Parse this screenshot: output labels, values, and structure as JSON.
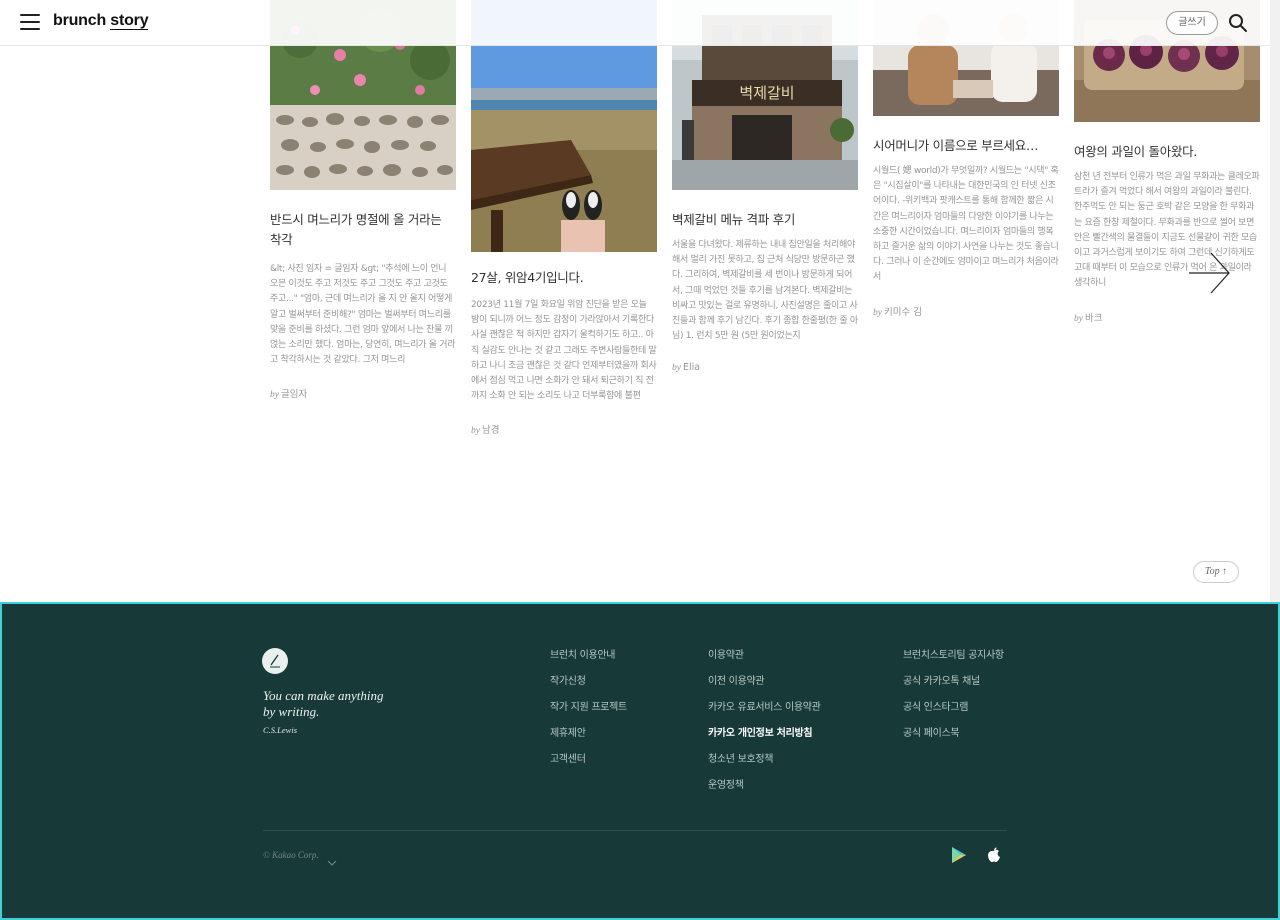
{
  "header": {
    "logo_text_a": "brunch",
    "logo_text_b": "story",
    "write_label": "글쓰기"
  },
  "articles": [
    {
      "title": "반드시 며느리가 명절에 올 거라는 착각",
      "desc": "&lt; 사진 임자 = 글임자 &gt; \"추석에 느이 언니 오믄 이것도 주고 저것도 주고 그것도 주고 고것도 주고...\" \"엄마, 근데 며느리가 올 지 안 올지 어떻게 알고 벌써부터 준비해?\" 엄마는 벌써부터 며느리를 맞을 준비를 하셨다. 그런 엄마 앞에서 나는 찬물 끼얹는 소리만 했다. 엄마는, 당연히, 며느리가 올 거라고 착각하시는 것 같았다. 그저 며느리",
      "by": "by",
      "author": "글임자"
    },
    {
      "title": "27살, 위암4기입니다.",
      "desc": "2023년 11월 7일 화요일 위암 진단을 받은 오늘 밤이 되니까 어느 정도 감정이 가라앉아서 기록한다 사실 괜찮은 척 하지만 갑자기 울컥하기도 하고.. 아직 실감도 안나는 것 같고 그래도 주변사람들한테 말하고 나니 조금 괜찮은 것 같다 언제부터였을까 회사에서 점심 먹고 나면 소화가 안 돼서 퇴근하기 직 전까지 소화 안 되는 소리도 나고 더부룩함에 불편",
      "by": "by",
      "author": "남경"
    },
    {
      "title": "벽제갈비 메뉴 격파 후기",
      "desc": "서울을 다녀왔다. 제류하는 내내 집안일을 처리해야 해서 멀리 가진 못하고, 집 근처 식당만 방문하곤 했다. 그리하여, 벽제갈비를 세 번이나 방문하게 되어서, 그때 먹었던 것들 후기를 남겨본다. 벽제갈비는 비싸고 맛있는 걸로 유명하니, 사진설명은 줄이고 사진들과 함께 후기 남긴다. 후기 종합 한줄평(한 줄 아님) 1. 런치 5만 원 (5만 원이었는지",
      "by": "by",
      "author": "Elia"
    },
    {
      "title": "시어머니가 이름으로 부르세요…",
      "desc": "시월드( 媤 world)가 무엇일까? 시월드는 \"시댁\" 혹은 \"시집살이\"를 나타내는 대한민국의 인 터넷 신조어이다. -위키백과 팟캐스트를 통해 함께한 짧은 시간은 며느리이자 엄마들의 다양한 이야기를 나누는 소중한 시간이었습니다. 며느리이자 엄마들의 행복하고 즐거운 삶의 이야기 사연을 나누는 것도 좋습니다. 그러나 이 순간에도 엄마이고 며느리가 처음이라서",
      "by": "by",
      "author": "키미수 김"
    },
    {
      "title": "여왕의 과일이 돌아왔다.",
      "desc": "삼천 년 전부터 인류가 먹은 과일 무화과는 클레오파트라가 즐겨 먹었다 해서 여왕의 과일이라 불린다. 한주먹도 안 되는 둥근 호박 같은 모양을 한 무화과는 요즘 한창 제철이다. 무화과를 반으로 썰어 보면 안은 빨간색의 물결들이 지금도 선물같이 귀한 모습이고 과거스럽게 보이기도 하여 그런데 신기하게도 고대 때부터 이 모습으로 인류가 먹어 온 과일이라 생각하니",
      "by": "by",
      "author": "바크"
    }
  ],
  "top_label": "Top ↑",
  "footer": {
    "quote_line1": "You can make anything",
    "quote_line2": "by writing.",
    "quote_author": "C.S.Lewis",
    "col1": [
      "브런치 이용안내",
      "작가신청",
      "작가 지원 프로젝트",
      "제휴제안",
      "고객센터"
    ],
    "col2": [
      "이용약관",
      "이전 이용약관",
      "카카오 유료서비스 이용약관",
      "카카오 개인정보 처리방침",
      "청소년 보호정책",
      "운영정책"
    ],
    "col3": [
      "브런치스토리팀 공지사항",
      "공식 카카오톡 채널",
      "공식 인스타그램",
      "공식 페이스북"
    ],
    "copyright": "© Kakao Corp."
  },
  "icons": {
    "menu": "hamburger-menu-icon",
    "search": "search-icon",
    "next": "chevron-right-icon",
    "play_store": "google-play-icon",
    "app_store": "apple-icon"
  },
  "colors": {
    "footer_bg": "#173a38",
    "footer_border": "#3fd0d6"
  }
}
